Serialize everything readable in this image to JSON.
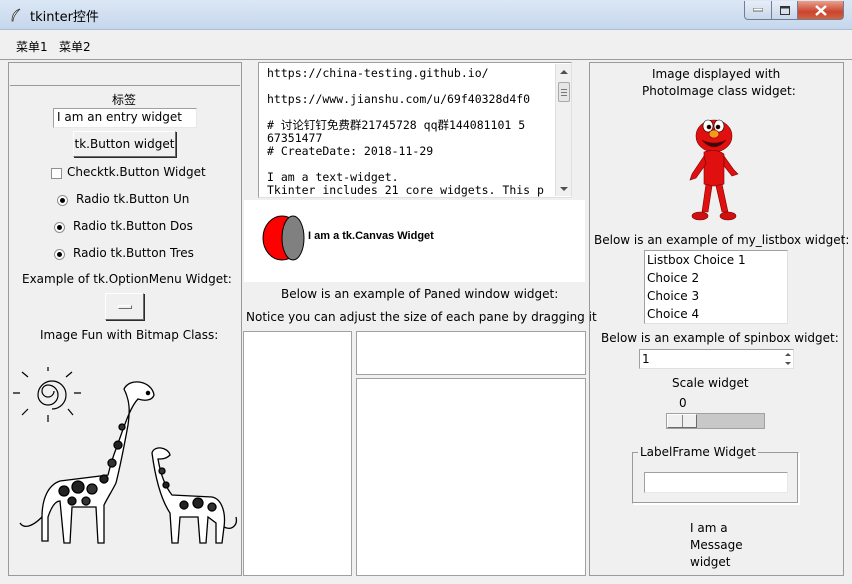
{
  "window": {
    "title": "tkinter控件"
  },
  "menu": {
    "items": [
      "菜单1",
      "菜单2"
    ]
  },
  "left": {
    "label": "标签",
    "entry_value": "I am an entry widget",
    "button_label": "tk.Button widget",
    "checkbox_label": "Checktk.Button Widget",
    "radios": [
      {
        "label": "Radio tk.Button  Un",
        "selected": true
      },
      {
        "label": "Radio tk.Button  Dos",
        "selected": true
      },
      {
        "label": "Radio tk.Button  Tres",
        "selected": true
      }
    ],
    "optionmenu_caption": "Example of tk.OptionMenu Widget:",
    "bitmap_caption": "Image Fun with Bitmap Class:"
  },
  "middle": {
    "text_lines": [
      "https://china-testing.github.io/",
      "",
      "https://www.jianshu.com/u/69f40328d4f0",
      "",
      "# 讨论钉钉免费群21745728 qq群144081101 5",
      "67351477",
      "# CreateDate: 2018-11-29",
      "",
      "I am a text-widget.",
      "Tkinter includes 21 core widgets. This p"
    ],
    "canvas_label": "I am a tk.Canvas Widget",
    "paned_caption_1": "Below is an example of Paned window widget:",
    "paned_caption_2": "Notice you can adjust the size of each pane by dragging it"
  },
  "right": {
    "photo_caption_1": "Image displayed with",
    "photo_caption_2": "PhotoImage class widget:",
    "listbox_caption": "Below is an example of my_listbox widget:",
    "listbox_items": [
      "Listbox Choice 1",
      "Choice 2",
      "Choice 3",
      "Choice 4"
    ],
    "spinbox_caption": "Below is an example of spinbox widget:",
    "spinbox_value": "1",
    "scale_caption": "Scale widget",
    "scale_value": "0",
    "scale_fraction": 0,
    "labelframe_title": "LabelFrame Widget",
    "labelframe_entry": "",
    "message_lines": [
      "I am a",
      "Message",
      "widget"
    ]
  },
  "colors": {
    "canvas_oval": "#ff0000",
    "canvas_oval2": "#808080"
  }
}
